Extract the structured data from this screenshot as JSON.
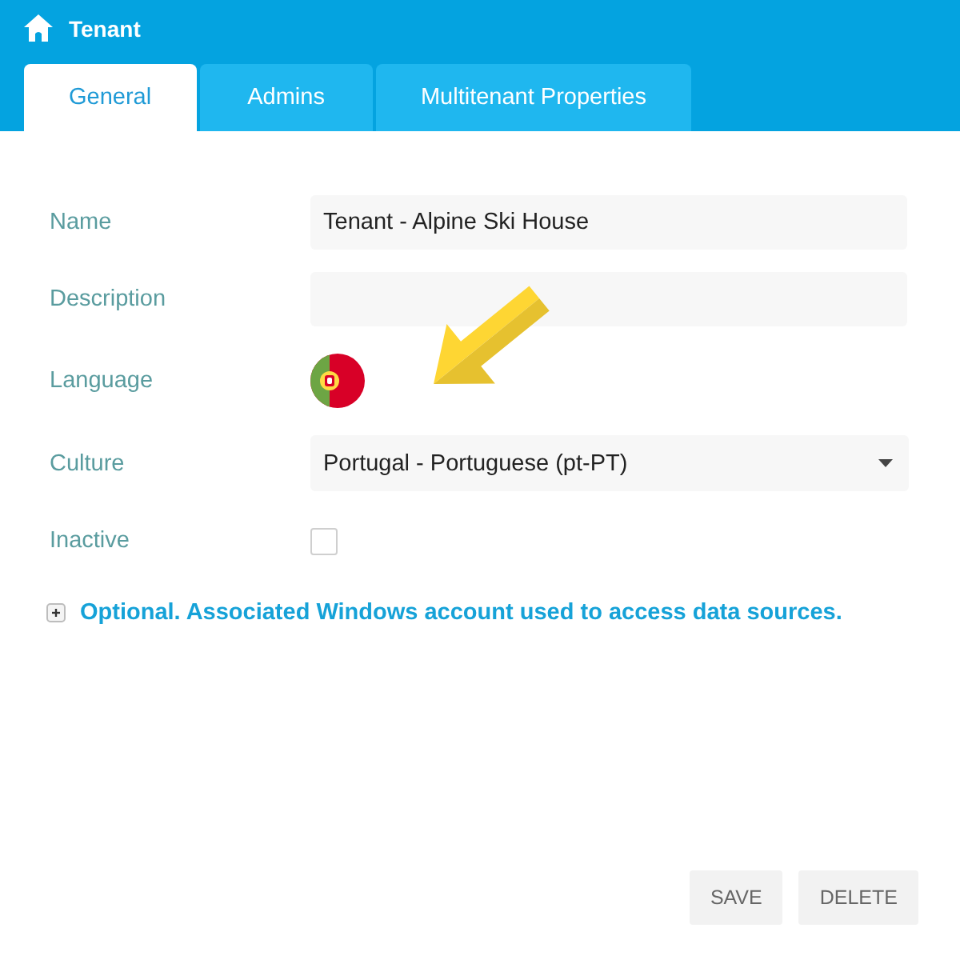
{
  "header": {
    "title": "Tenant"
  },
  "tabs": [
    {
      "label": "General",
      "selected": true
    },
    {
      "label": "Admins",
      "selected": false
    },
    {
      "label": "Multitenant Properties",
      "selected": false
    }
  ],
  "form": {
    "fields": [
      {
        "kind": "text",
        "label": "Name",
        "value": "Tenant - Alpine Ski House"
      },
      {
        "kind": "text",
        "label": "Description"
      },
      {
        "kind": "flag",
        "label": "Language"
      },
      {
        "kind": "select",
        "label": "Culture",
        "value": "Portugal - Portuguese (pt-PT)"
      },
      {
        "kind": "checkbox",
        "label": "Inactive",
        "checked": false
      }
    ]
  },
  "optional_section": {
    "label": "Optional. Associated Windows account used to access data sources.",
    "expanded": false
  },
  "buttons": [
    "SAVE",
    "DELETE"
  ]
}
